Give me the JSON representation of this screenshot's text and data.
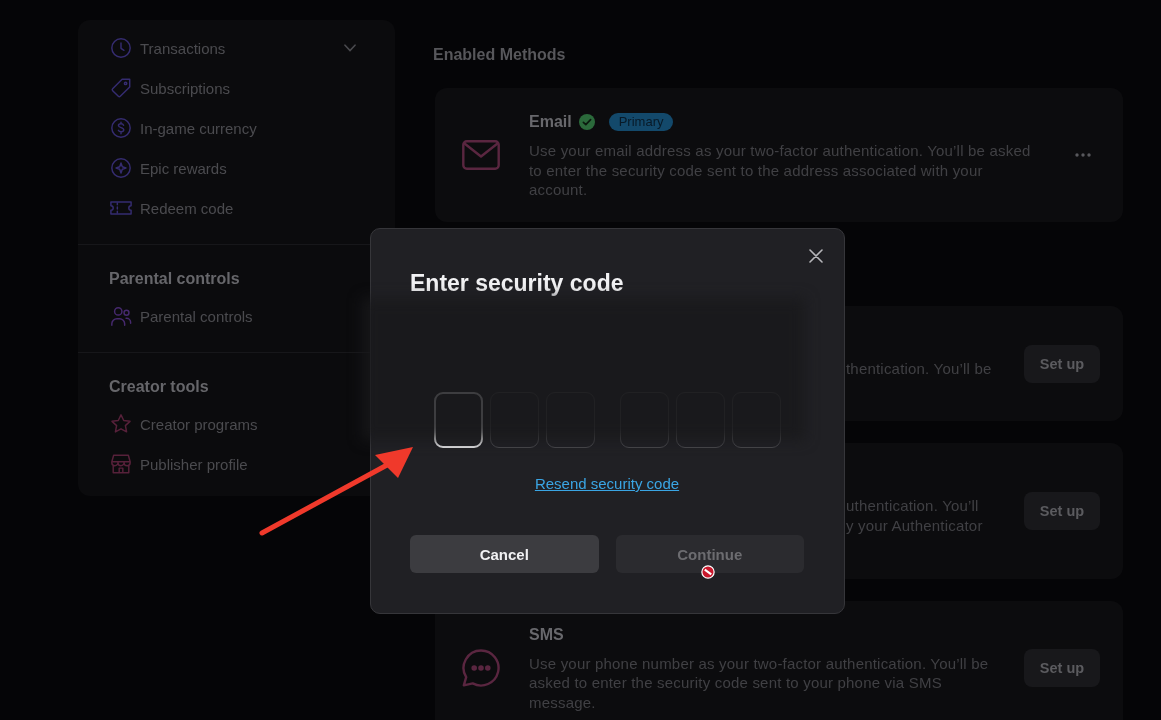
{
  "sidebar": {
    "sections": [
      {
        "items": [
          {
            "label": "Transactions",
            "kind": "group",
            "expanded": false
          },
          {
            "label": "Subscriptions",
            "kind": "link"
          },
          {
            "label": "In-game currency",
            "kind": "link"
          },
          {
            "label": "Epic rewards",
            "kind": "link"
          },
          {
            "label": "Redeem code",
            "kind": "link"
          }
        ]
      },
      {
        "heading": "Parental controls",
        "items": [
          {
            "label": "Parental controls",
            "kind": "link"
          }
        ]
      },
      {
        "heading": "Creator tools",
        "items": [
          {
            "label": "Creator programs",
            "kind": "link"
          },
          {
            "label": "Publisher profile",
            "kind": "link"
          }
        ]
      }
    ]
  },
  "main": {
    "heading": "Enabled Methods",
    "methods": [
      {
        "kind": "enabled",
        "title": "Email",
        "verified": true,
        "badge": "Primary",
        "description": "Use your email address as your two-factor authentication. You’ll be asked to enter the security code sent to the address associated with your account."
      },
      {
        "kind": "covered",
        "description_lines": [
          "thentication. You’ll be"
        ],
        "button": "Set up"
      },
      {
        "kind": "covered",
        "description_lines": [
          "uthentication. You’ll",
          "y your Authenticator"
        ],
        "button": "Set up"
      },
      {
        "kind": "available",
        "title": "SMS",
        "description": "Use your phone number as your two-factor authentication. You’ll be asked to enter the security code sent to your phone via SMS message.",
        "button": "Set up"
      }
    ]
  },
  "dialog": {
    "title": "Enter security code",
    "code_boxes": [
      {
        "focused": true
      },
      {
        "focused": false
      },
      {
        "focused": false
      },
      {
        "focused": false
      },
      {
        "focused": false
      },
      {
        "focused": false
      }
    ],
    "link": "Resend security code",
    "buttons": [
      {
        "label": "Cancel",
        "disabled": false
      },
      {
        "label": "Continue",
        "disabled": true
      }
    ]
  }
}
